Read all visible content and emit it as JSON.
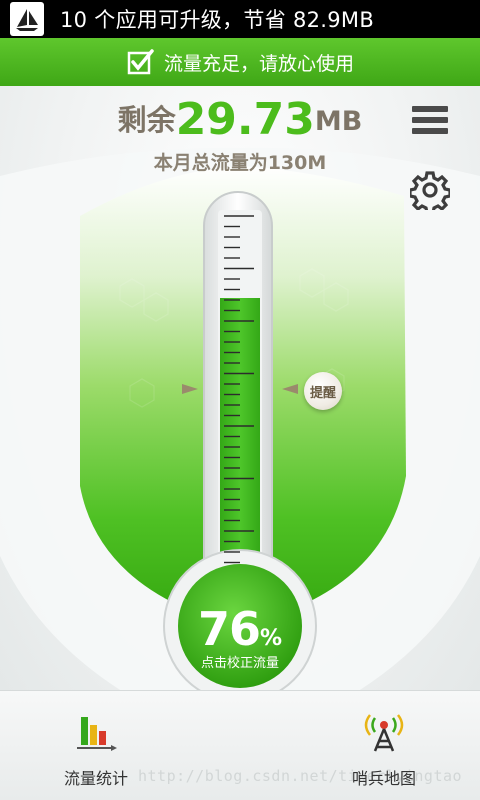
{
  "status_bar": {
    "text": "10 个应用可升级，节省 82.9MB",
    "app_icon": "sailboat-icon"
  },
  "banner": {
    "icon": "checkbox-check-icon",
    "text": "流量充足，请放心使用"
  },
  "usage": {
    "remaining_prefix": "剩余",
    "remaining_value": "29.73",
    "remaining_unit": "MB",
    "total_text": "本月总流量为130M",
    "used_percent": 76,
    "percent_sign": "%",
    "calibrate_label": "点击校正流量",
    "reminder_label": "提醒"
  },
  "toolbar": {
    "menu_icon": "menu-icon",
    "settings_icon": "gear-icon"
  },
  "bottom_nav": {
    "stats_label": "流量统计",
    "map_label": "哨兵地图",
    "watermark": "http://blog.csdn.net/tiwerlyingtao"
  },
  "colors": {
    "accent": "#4cbc1c",
    "banner": "#4db421",
    "text_brown": "#7d7466"
  }
}
